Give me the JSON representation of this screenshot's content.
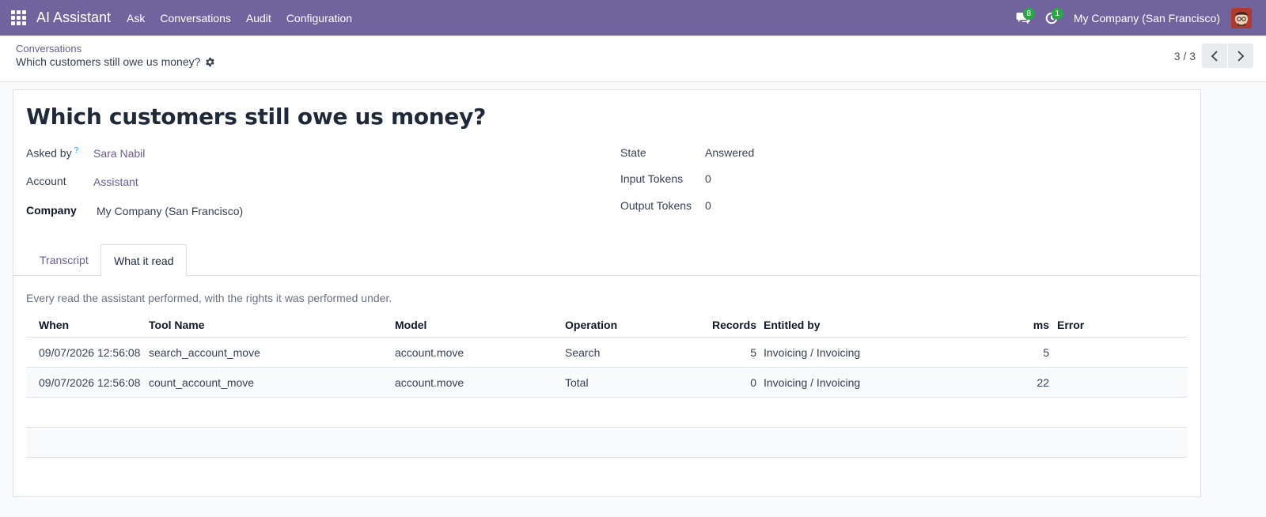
{
  "navbar": {
    "app_name": "AI Assistant",
    "menu": [
      "Ask",
      "Conversations",
      "Audit",
      "Configuration"
    ],
    "messages_count": "8",
    "activities_count": "1",
    "company": "My Company (San Francisco)"
  },
  "breadcrumb": {
    "parent": "Conversations",
    "current": "Which customers still owe us money?"
  },
  "pager": {
    "value": "3 / 3"
  },
  "form": {
    "title": "Which customers still owe us money?",
    "asked_by_label": "Asked by",
    "asked_by_help": "?",
    "asked_by_value": "Sara Nabil",
    "account_label": "Account",
    "account_value": "Assistant",
    "company_label": "Company",
    "company_value": "My Company (San Francisco)",
    "state_label": "State",
    "state_value": "Answered",
    "input_tokens_label": "Input Tokens",
    "input_tokens_value": "0",
    "output_tokens_label": "Output Tokens",
    "output_tokens_value": "0"
  },
  "tabs": [
    {
      "label": "Transcript",
      "active": false
    },
    {
      "label": "What it read",
      "active": true
    }
  ],
  "tab_description": "Every read the assistant performed, with the rights it was performed under.",
  "table": {
    "columns": [
      "When",
      "Tool Name",
      "Model",
      "Operation",
      "Records",
      "Entitled by",
      "ms",
      "Error"
    ],
    "rows": [
      [
        "09/07/2026 12:56:08",
        "search_account_move",
        "account.move",
        "Search",
        "5",
        "Invoicing / Invoicing",
        "5",
        ""
      ],
      [
        "09/07/2026 12:56:08",
        "count_account_move",
        "account.move",
        "Total",
        "0",
        "Invoicing / Invoicing",
        "22",
        ""
      ]
    ]
  },
  "colors": {
    "navbar": "#71639e",
    "link": "#6b5b95",
    "badge": "#28a745"
  }
}
